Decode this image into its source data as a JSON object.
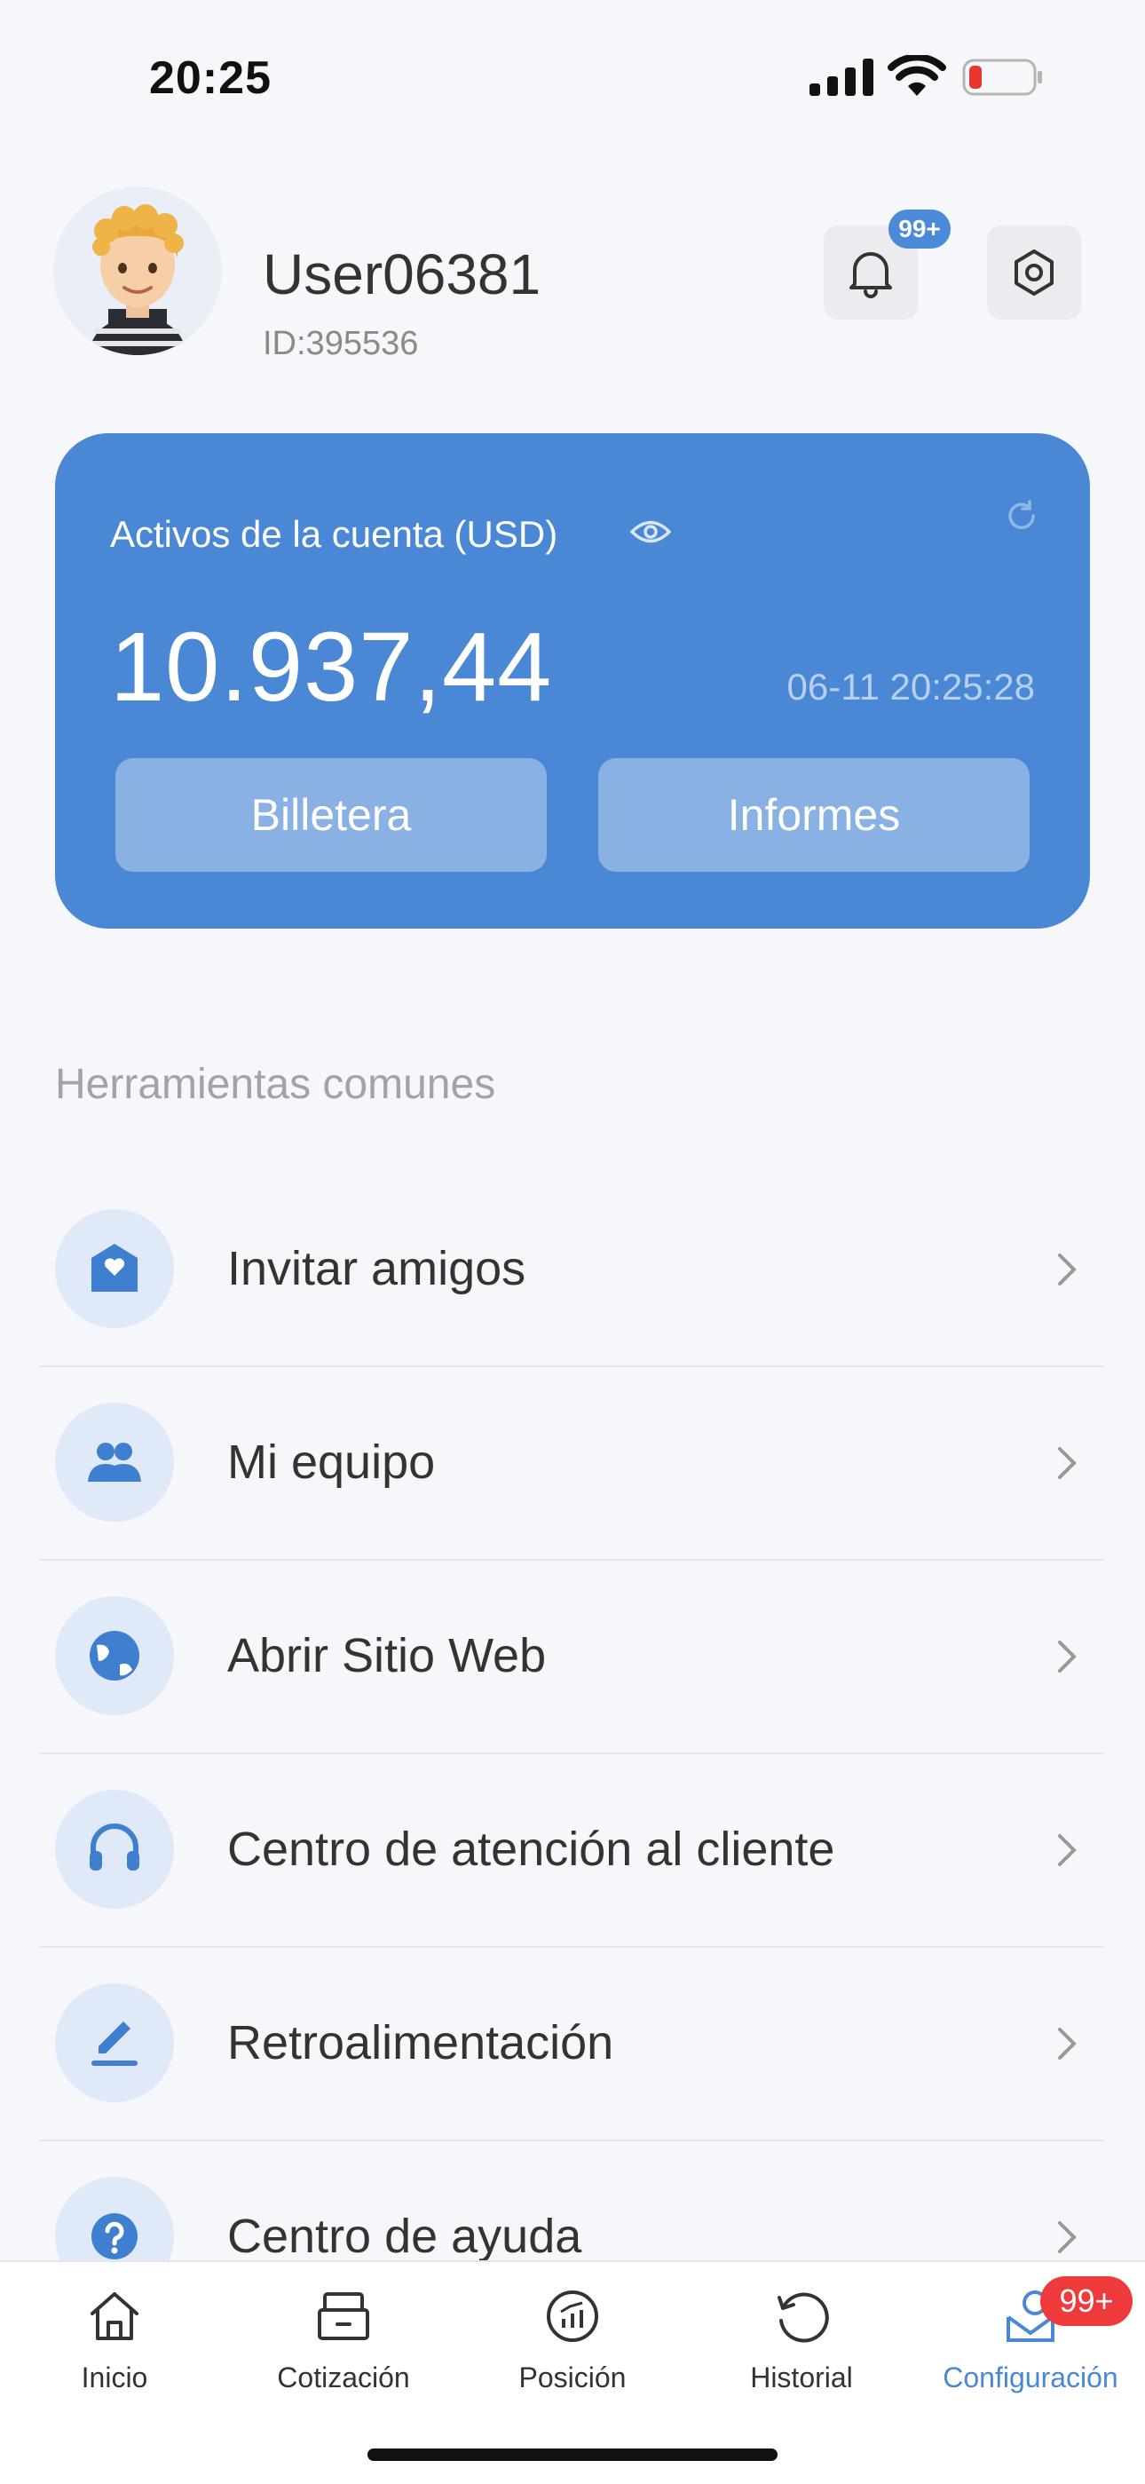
{
  "status_bar": {
    "time": "20:25"
  },
  "profile": {
    "username": "User06381",
    "user_id": "ID:395536",
    "notification_badge": "99+"
  },
  "account_card": {
    "assets_label": "Activos de la cuenta (USD)",
    "balance": "10.937,44",
    "timestamp": "06-11 20:25:28",
    "wallet_label": "Billetera",
    "reports_label": "Informes"
  },
  "tools": {
    "title": "Herramientas comunes",
    "items": [
      {
        "label": "Invitar amigos",
        "icon": "mail-heart-icon"
      },
      {
        "label": "Mi equipo",
        "icon": "team-icon"
      },
      {
        "label": "Abrir Sitio Web",
        "icon": "globe-icon"
      },
      {
        "label": "Centro de atención al cliente",
        "icon": "headset-icon"
      },
      {
        "label": "Retroalimentación",
        "icon": "pen-icon"
      },
      {
        "label": "Centro de ayuda",
        "icon": "help-icon"
      }
    ]
  },
  "bottom_nav": {
    "items": [
      {
        "label": "Inicio",
        "icon": "home-icon"
      },
      {
        "label": "Cotización",
        "icon": "quote-icon"
      },
      {
        "label": "Posición",
        "icon": "chart-icon"
      },
      {
        "label": "Historial",
        "icon": "history-icon"
      },
      {
        "label": "Configuración",
        "icon": "profile-icon",
        "badge": "99+",
        "active": true
      }
    ]
  },
  "colors": {
    "accent": "#4a88d6",
    "badge_red": "#ee3a3a",
    "background": "#f6f7fb"
  }
}
